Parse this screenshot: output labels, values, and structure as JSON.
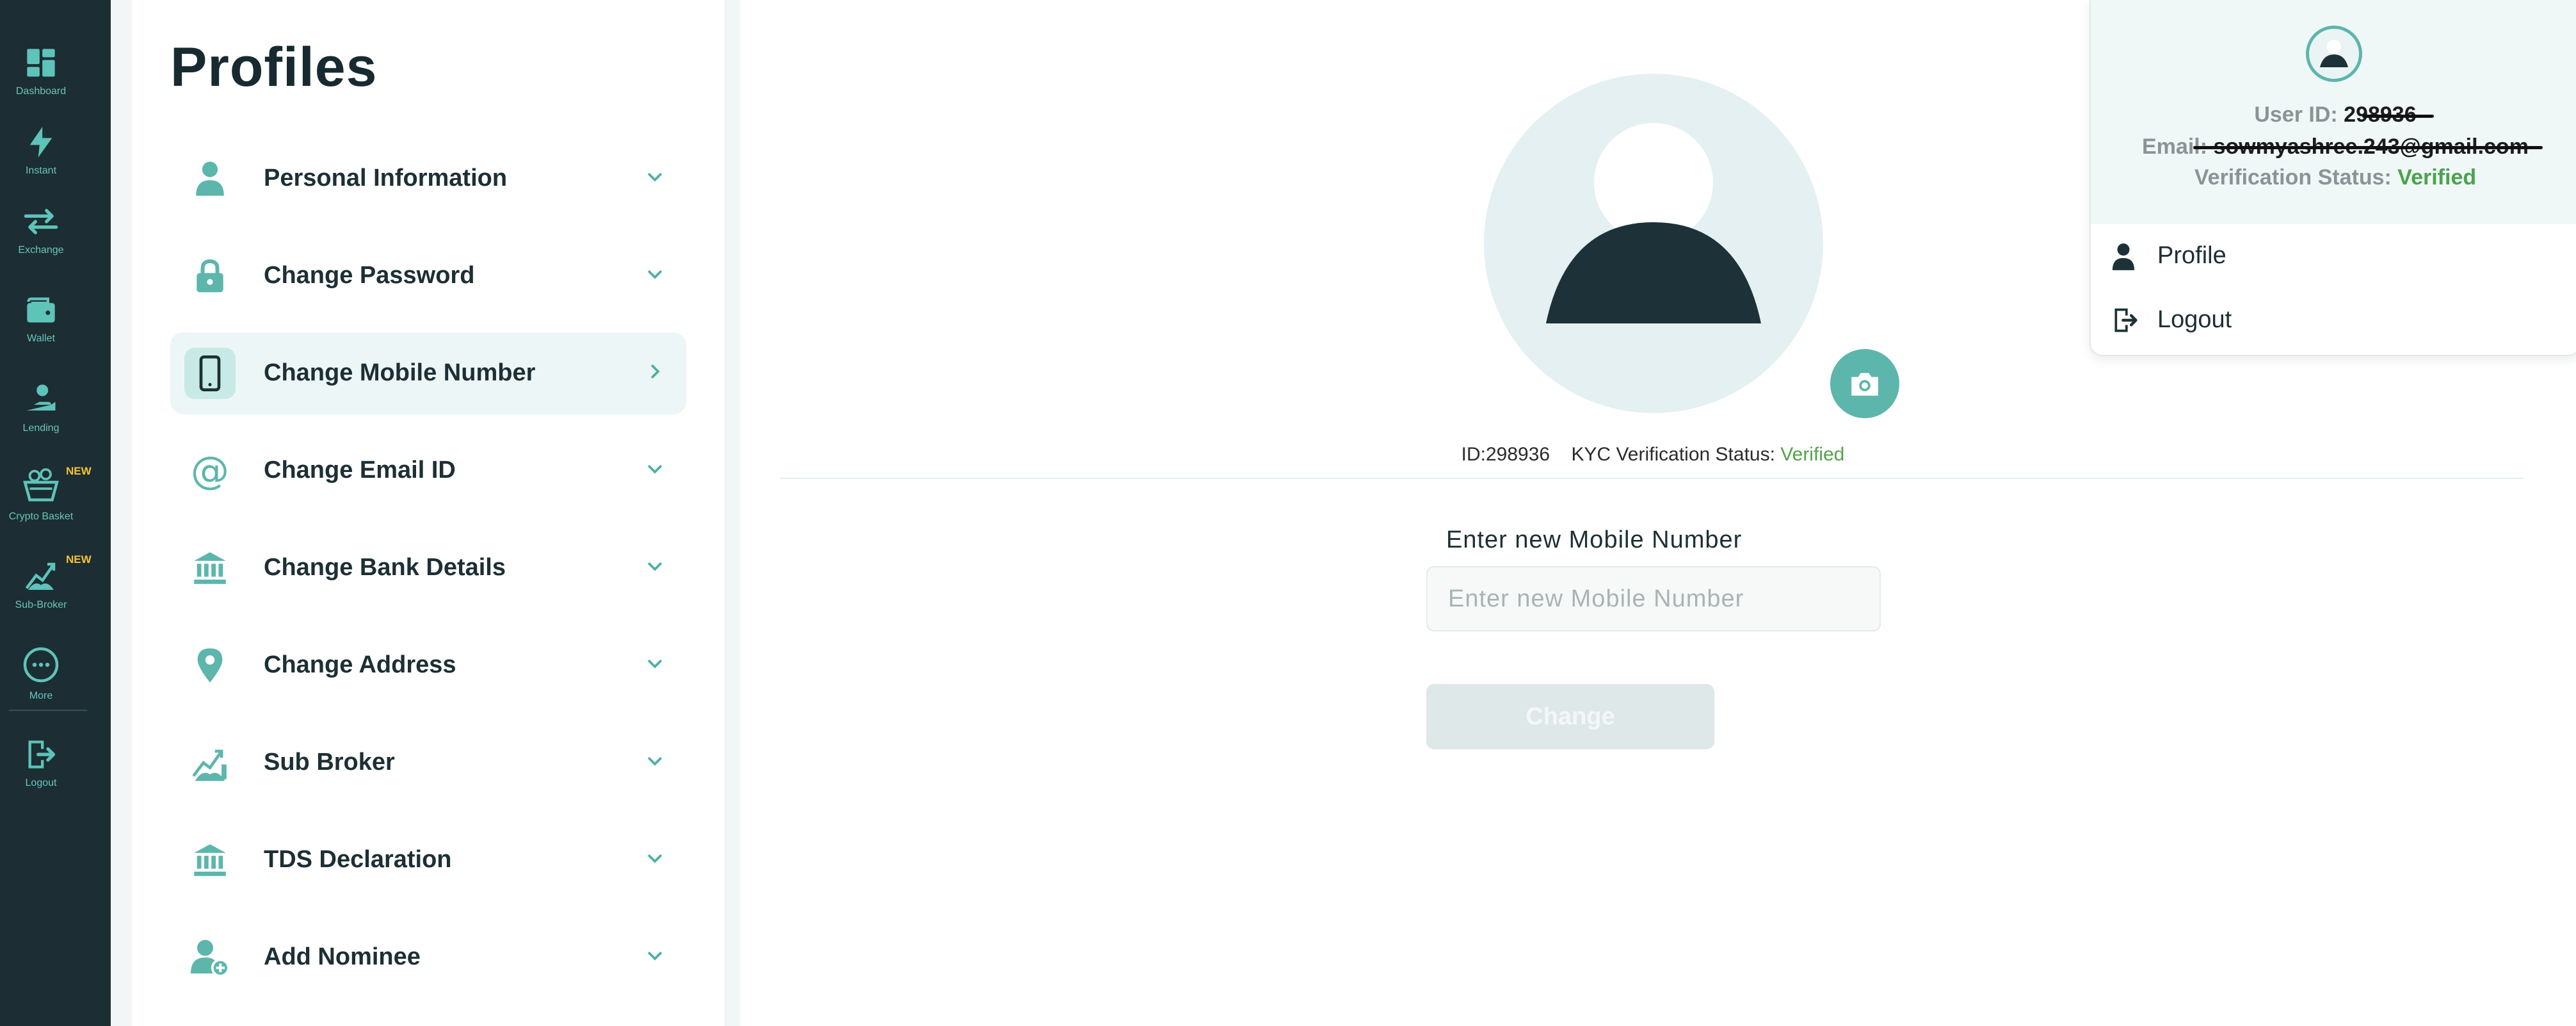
{
  "nav": {
    "items": [
      {
        "label": "Dashboard",
        "icon": "dashboard-icon"
      },
      {
        "label": "Instant",
        "icon": "lightning-icon"
      },
      {
        "label": "Exchange",
        "icon": "exchange-icon"
      },
      {
        "label": "Wallet",
        "icon": "wallet-icon"
      },
      {
        "label": "Lending",
        "icon": "lending-icon"
      },
      {
        "label": "Crypto Basket",
        "icon": "basket-icon",
        "badge": "NEW"
      },
      {
        "label": "Sub-Broker",
        "icon": "sub-broker-icon",
        "badge": "NEW"
      },
      {
        "label": "More",
        "icon": "more-icon"
      },
      {
        "label": "Logout",
        "icon": "logout-icon"
      }
    ]
  },
  "profiles": {
    "title": "Profiles",
    "items": [
      {
        "label": "Personal Information",
        "icon": "user-icon"
      },
      {
        "label": "Change Password",
        "icon": "lock-icon"
      },
      {
        "label": "Change Mobile Number",
        "icon": "mobile-icon",
        "active": true
      },
      {
        "label": "Change Email ID",
        "icon": "at-icon"
      },
      {
        "label": "Change Bank Details",
        "icon": "bank-icon"
      },
      {
        "label": "Change Address",
        "icon": "location-pin-icon"
      },
      {
        "label": "Sub Broker",
        "icon": "sub-broker-icon"
      },
      {
        "label": "TDS Declaration",
        "icon": "bank-icon"
      },
      {
        "label": "Add Nominee",
        "icon": "add-user-icon"
      }
    ]
  },
  "main": {
    "id_text": "ID:298936",
    "kyc_label": "KYC Verification Status:",
    "kyc_status": "Verified",
    "field_label": "Enter new Mobile Number",
    "field_placeholder": "Enter new Mobile Number",
    "field_value": "",
    "button_label": "Change"
  },
  "dropdown": {
    "user_id_label": "User ID:",
    "user_id_value": "298936",
    "email_label": "Email:",
    "email_value": "sowmyashree.243@gmail.com",
    "verification_label": "Verification Status:",
    "verification_value": "Verified",
    "menu": [
      {
        "label": "Profile",
        "icon": "user-icon"
      },
      {
        "label": "Logout",
        "icon": "logout-icon"
      }
    ]
  },
  "colors": {
    "accent": "#5cb6ac",
    "nav_bg": "#1c2d33",
    "verified": "#4aa34c",
    "badge": "#f5c330"
  }
}
